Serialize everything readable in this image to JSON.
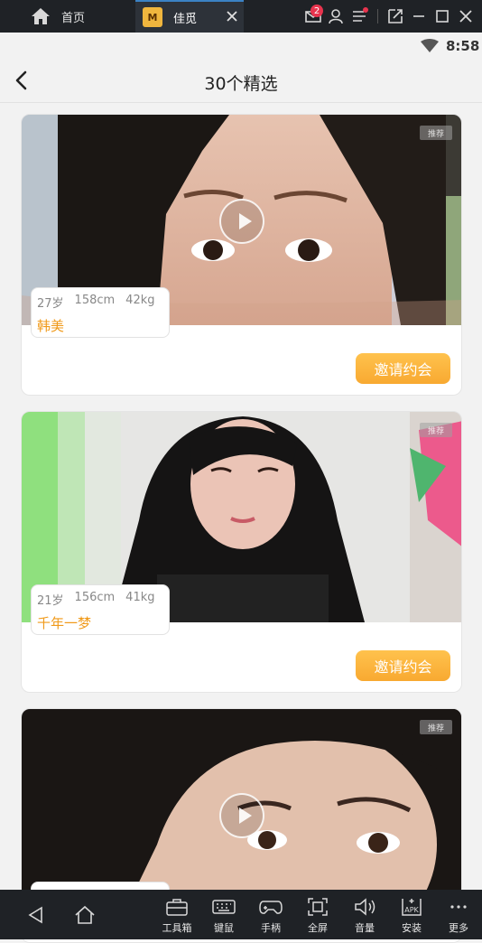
{
  "emulator": {
    "home_label": "首页",
    "tab": {
      "icon_letter": "M",
      "label": "佳觅"
    },
    "mail_badge": "2",
    "toolbar": [
      {
        "name": "toolbox",
        "label": "工具箱"
      },
      {
        "name": "keyboard-mouse",
        "label": "键鼠"
      },
      {
        "name": "gamepad",
        "label": "手柄"
      },
      {
        "name": "fullscreen",
        "label": "全屏"
      },
      {
        "name": "volume",
        "label": "音量"
      },
      {
        "name": "install-apk",
        "label": "安装",
        "icon_text": "APK"
      },
      {
        "name": "more",
        "label": "更多"
      }
    ]
  },
  "status_bar": {
    "time": "8:58"
  },
  "header": {
    "title": "30个精选"
  },
  "cards": [
    {
      "age": "27岁",
      "height": "158cm",
      "weight": "42kg",
      "name": "韩美",
      "tag": "推荐",
      "invite_label": "邀请约会",
      "has_video": true
    },
    {
      "age": "21岁",
      "height": "156cm",
      "weight": "41kg",
      "name": "千年一梦",
      "tag": "推荐",
      "invite_label": "邀请约会",
      "has_video": false
    },
    {
      "age": "",
      "height": "",
      "weight": "",
      "name": "",
      "tag": "推荐",
      "invite_label": "",
      "has_video": true
    }
  ]
}
